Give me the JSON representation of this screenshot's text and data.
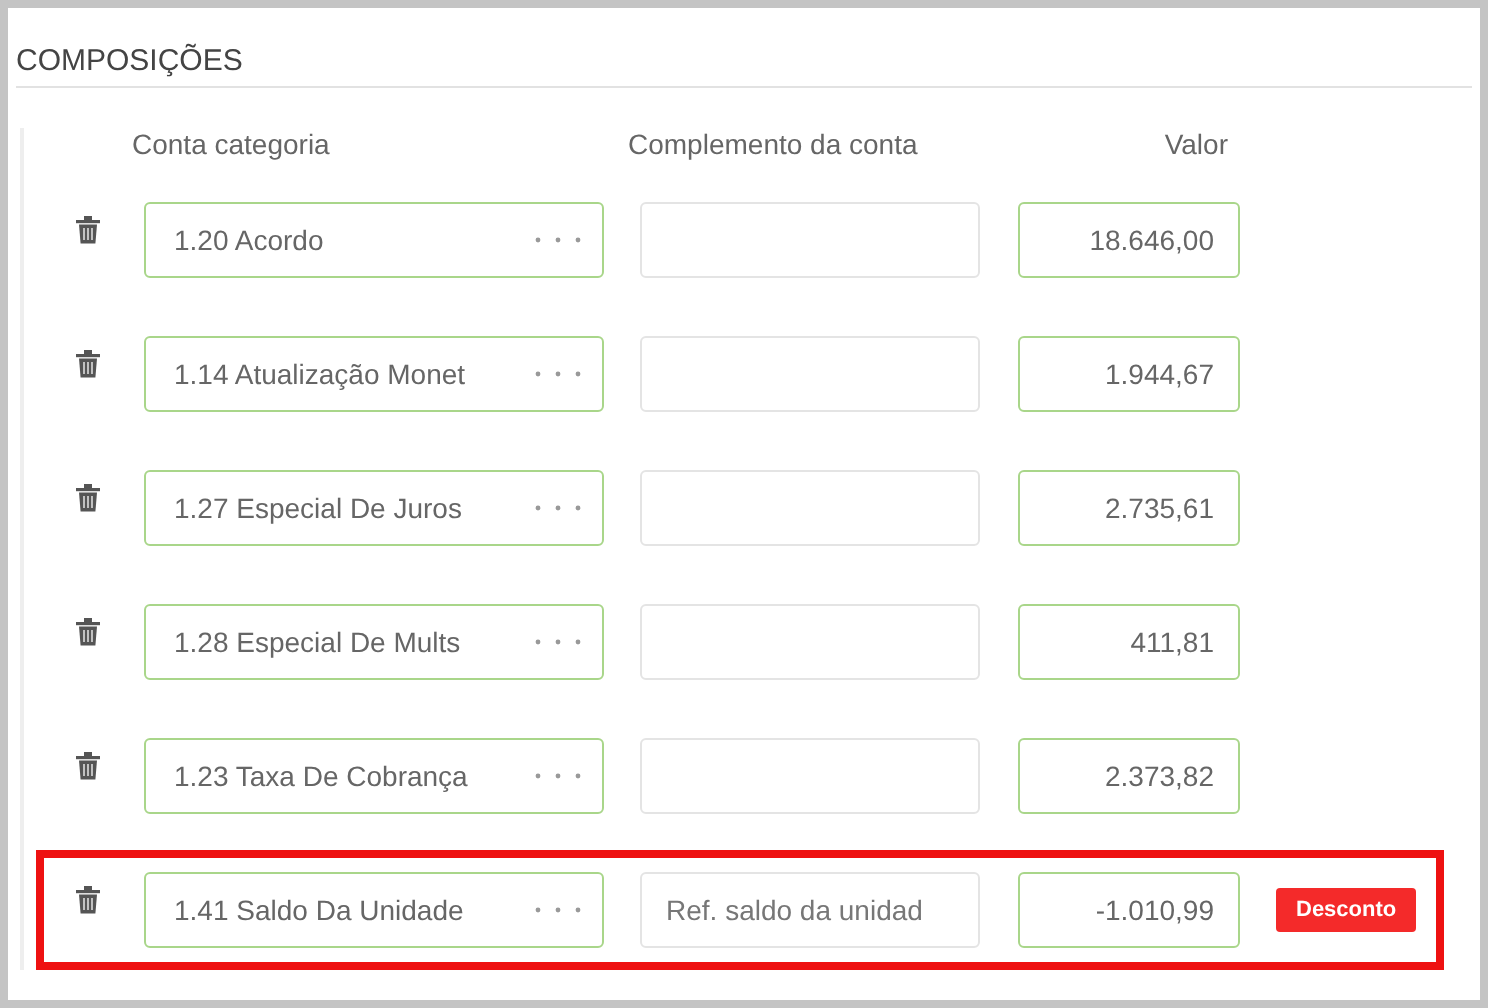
{
  "section_title": "COMPOSIÇÕES",
  "columns": [
    "Conta categoria",
    "Complemento da conta",
    "Valor"
  ],
  "rows": [
    {
      "category": "1.20  Acordo",
      "complement": "",
      "value": "18.646,00",
      "highlighted": false
    },
    {
      "category": "1.14  Atualização Monet",
      "complement": "",
      "value": "1.944,67",
      "highlighted": false
    },
    {
      "category": "1.27  Especial De Juros",
      "complement": "",
      "value": "2.735,61",
      "highlighted": false
    },
    {
      "category": "1.28  Especial De Mults",
      "complement": "",
      "value": "411,81",
      "highlighted": false
    },
    {
      "category": "1.23  Taxa De Cobrança",
      "complement": "",
      "value": "2.373,82",
      "highlighted": false
    },
    {
      "category": "1.41  Saldo Da Unidade",
      "complement": "Ref. saldo da unidad",
      "value": "-1.010,99",
      "highlighted": true,
      "badge": "Desconto"
    }
  ]
}
